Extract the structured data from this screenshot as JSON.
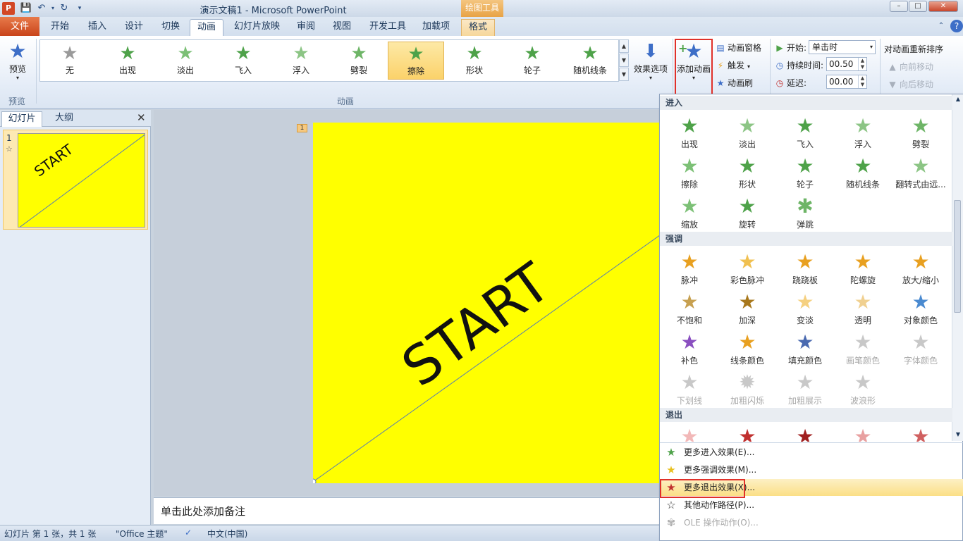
{
  "app": {
    "title": "演示文稿1  -  Microsoft PowerPoint",
    "logo": "P",
    "contextual_tab_header": "绘图工具"
  },
  "colors": {
    "accent": "#d24726",
    "slide_bg": "#ffff00",
    "highlight_box": "#e0312a",
    "star_green": "#4ea249",
    "star_gold": "#e8a020",
    "star_red": "#c0302f"
  },
  "quick_access": {
    "save_icon": "save-icon",
    "undo_icon": "undo-icon",
    "redo_icon": "redo-icon",
    "customize_icon": "customize-icon"
  },
  "tabs": [
    "开始",
    "插入",
    "设计",
    "切换",
    "动画",
    "幻灯片放映",
    "审阅",
    "视图",
    "开发工具",
    "加载项",
    "格式"
  ],
  "file_tab": "文件",
  "active_tab": "动画",
  "ribbon": {
    "preview": {
      "label": "预览",
      "group": "预览"
    },
    "gallery": {
      "group": "动画",
      "items": [
        {
          "label": "无",
          "icon": "star-gray-icon"
        },
        {
          "label": "出现",
          "icon": "star-green-icon"
        },
        {
          "label": "淡出",
          "icon": "star-green-icon"
        },
        {
          "label": "飞入",
          "icon": "star-green-icon"
        },
        {
          "label": "浮入",
          "icon": "star-green-icon"
        },
        {
          "label": "劈裂",
          "icon": "star-green-icon"
        },
        {
          "label": "擦除",
          "icon": "star-green-icon"
        },
        {
          "label": "形状",
          "icon": "star-green-icon"
        },
        {
          "label": "轮子",
          "icon": "star-green-icon"
        },
        {
          "label": "随机线条",
          "icon": "star-green-icon"
        }
      ],
      "selected": "擦除"
    },
    "effect_options": "效果选项",
    "add_animation": "添加动画",
    "animation_pane": "动画窗格",
    "trigger": "触发",
    "animation_painter": "动画刷",
    "timing": {
      "start_label": "开始:",
      "start_value": "单击时",
      "duration_label": "持续时间:",
      "duration_value": "00.50",
      "delay_label": "延迟:",
      "delay_value": "00.00"
    },
    "reorder": {
      "title": "对动画重新排序",
      "move_earlier": "向前移动",
      "move_later": "向后移动"
    }
  },
  "left_panel": {
    "tabs": [
      "幻灯片",
      "大纲"
    ],
    "slide_number": "1",
    "thumb_text": "START"
  },
  "slide": {
    "text": "START",
    "badge": "1"
  },
  "notes_placeholder": "单击此处添加备注",
  "status_bar": {
    "slide_info": "幻灯片 第 1 张，共 1 张",
    "theme": "\"Office 主题\"",
    "language": "中文(中国)"
  },
  "dropdown": {
    "entrance": {
      "header": "进入",
      "items": [
        "出现",
        "淡出",
        "飞入",
        "浮入",
        "劈裂",
        "擦除",
        "形状",
        "轮子",
        "随机线条",
        "翻转式由远...",
        "缩放",
        "旋转",
        "弹跳"
      ]
    },
    "emphasis": {
      "header": "强调",
      "items": [
        "脉冲",
        "彩色脉冲",
        "跷跷板",
        "陀螺旋",
        "放大/缩小",
        "不饱和",
        "加深",
        "变淡",
        "透明",
        "对象颜色",
        "补色",
        "线条颜色",
        "填充颜色",
        "画笔颜色",
        "字体颜色",
        "下划线",
        "加粗闪烁",
        "加粗展示",
        "波浪形"
      ],
      "disabled": [
        "画笔颜色",
        "字体颜色",
        "下划线",
        "加粗闪烁",
        "加粗展示",
        "波浪形"
      ]
    },
    "exit": {
      "header": "退出"
    },
    "commands": [
      {
        "label": "更多进入效果(E)...",
        "icon": "green-star-icon"
      },
      {
        "label": "更多强调效果(M)...",
        "icon": "yellow-star-icon"
      },
      {
        "label": "更多退出效果(X)...",
        "icon": "red-star-icon"
      },
      {
        "label": "其他动作路径(P)...",
        "icon": "outline-star-icon"
      },
      {
        "label": "OLE 操作动作(O)...",
        "icon": "ole-icon"
      }
    ]
  }
}
